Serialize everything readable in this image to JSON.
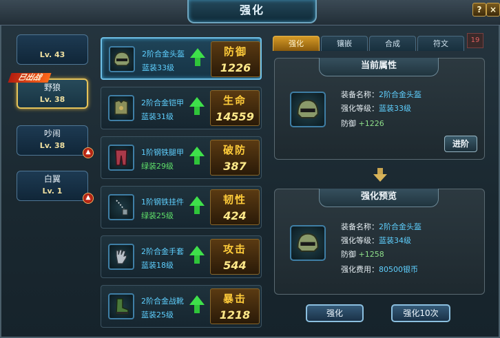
{
  "window": {
    "title": "强化",
    "help_label": "?",
    "close_label": "×"
  },
  "characters": [
    {
      "name": "",
      "level": "Lv. 43",
      "selected": false,
      "deployed": false,
      "upgrade_badge": false
    },
    {
      "name": "野狼",
      "level": "Lv. 38",
      "selected": true,
      "deployed": true,
      "upgrade_badge": false
    },
    {
      "name": "吵闹",
      "level": "Lv. 38",
      "selected": false,
      "deployed": false,
      "upgrade_badge": true
    },
    {
      "name": "白翼",
      "level": "Lv. 1",
      "selected": false,
      "deployed": false,
      "upgrade_badge": true
    }
  ],
  "deployed_label": "已出战",
  "equipment": [
    {
      "name": "2阶合金头盔",
      "grade": "蓝装33级",
      "stat": "防御",
      "value": "1226",
      "icon": "helmet-icon"
    },
    {
      "name": "2阶合金铠甲",
      "grade": "蓝装31级",
      "stat": "生命",
      "value": "14559",
      "icon": "armor-icon"
    },
    {
      "name": "1阶钢铁腿甲",
      "grade": "绿装29级",
      "stat": "破防",
      "value": "387",
      "icon": "leg-armor-icon"
    },
    {
      "name": "1阶钢铁挂件",
      "grade": "绿装25级",
      "stat": "韧性",
      "value": "424",
      "icon": "pendant-icon"
    },
    {
      "name": "2阶合金手套",
      "grade": "蓝装18级",
      "stat": "攻击",
      "value": "544",
      "icon": "glove-icon"
    },
    {
      "name": "2阶合金战靴",
      "grade": "蓝装25级",
      "stat": "暴击",
      "value": "1218",
      "icon": "boot-icon"
    }
  ],
  "tabs": [
    "强化",
    "镶嵌",
    "合成",
    "符文"
  ],
  "tab_count": "19",
  "current": {
    "header": "当前属性",
    "name_label": "装备名称：",
    "name_value": "2阶合金头盔",
    "level_label": "强化等级：",
    "level_value": "蓝装33级",
    "stat_label": "防御",
    "stat_value": "+1226",
    "advance_button": "进阶"
  },
  "preview": {
    "header": "强化预览",
    "name_label": "装备名称：",
    "name_value": "2阶合金头盔",
    "level_label": "强化等级：",
    "level_value": "蓝装34级",
    "stat_label": "防御",
    "stat_value": "+1258",
    "cost_label": "强化费用：",
    "cost_value": "80500银币"
  },
  "buttons": {
    "strengthen": "强化",
    "strengthen_ten": "强化10次"
  }
}
